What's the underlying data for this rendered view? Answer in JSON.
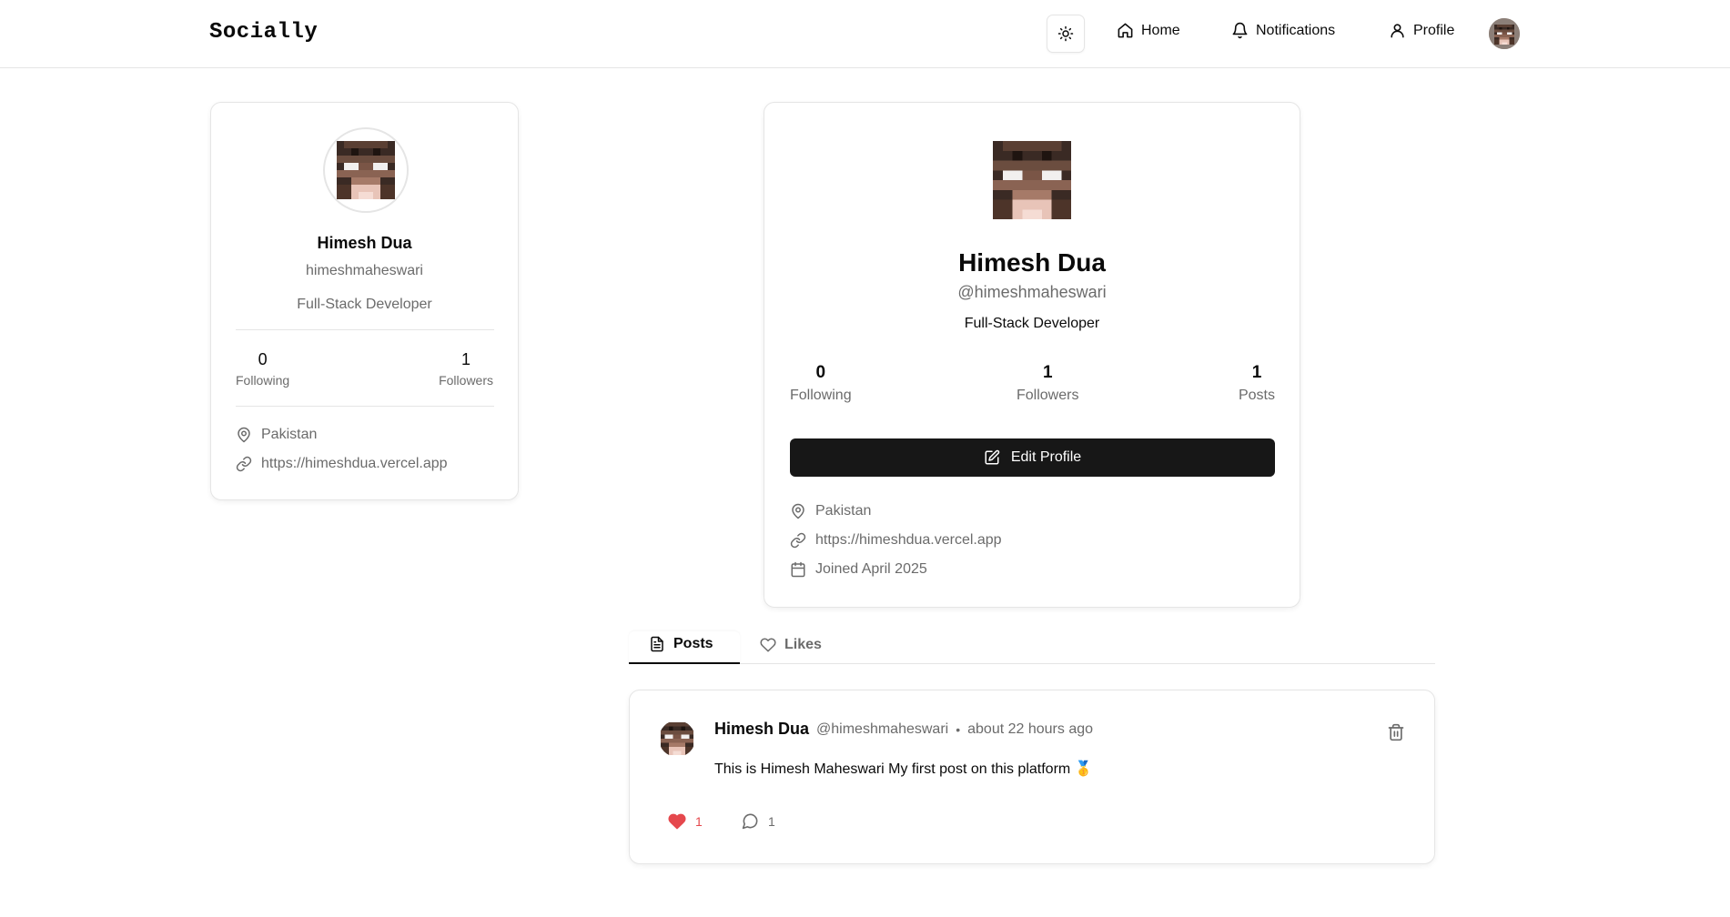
{
  "header": {
    "logo": "Socially",
    "nav": {
      "home": "Home",
      "notifications": "Notifications",
      "profile": "Profile"
    }
  },
  "sidebar_card": {
    "name": "Himesh Dua",
    "username": "himeshmaheswari",
    "bio": "Full-Stack Developer",
    "following_count": "0",
    "following_label": "Following",
    "followers_count": "1",
    "followers_label": "Followers",
    "location": "Pakistan",
    "website": "https://himeshdua.vercel.app"
  },
  "profile": {
    "name": "Himesh Dua",
    "username": "@himeshmaheswari",
    "bio": "Full-Stack Developer",
    "stats": {
      "following_count": "0",
      "following_label": "Following",
      "followers_count": "1",
      "followers_label": "Followers",
      "posts_count": "1",
      "posts_label": "Posts"
    },
    "edit_button": "Edit Profile",
    "location": "Pakistan",
    "website": "https://himeshdua.vercel.app",
    "joined": "Joined April 2025"
  },
  "tabs": {
    "posts": "Posts",
    "likes": "Likes",
    "active": "posts"
  },
  "post": {
    "author": "Himesh Dua",
    "handle": "@himeshmaheswari",
    "separator": "•",
    "time": "about 22 hours ago",
    "content": "This is Himesh Maheswari My first post on this platform 🥇",
    "likes": "1",
    "comments": "1",
    "liked": true
  },
  "colors": {
    "like": "#e5484d",
    "button_bg": "#171717",
    "muted_text": "#6b6b6b",
    "border": "#e5e5e5"
  },
  "icons": [
    "sun-icon",
    "home-icon",
    "bell-icon",
    "user-icon",
    "map-pin-icon",
    "link-icon",
    "calendar-icon",
    "edit-icon",
    "file-text-icon",
    "heart-icon",
    "message-circle-icon",
    "trash-icon"
  ]
}
